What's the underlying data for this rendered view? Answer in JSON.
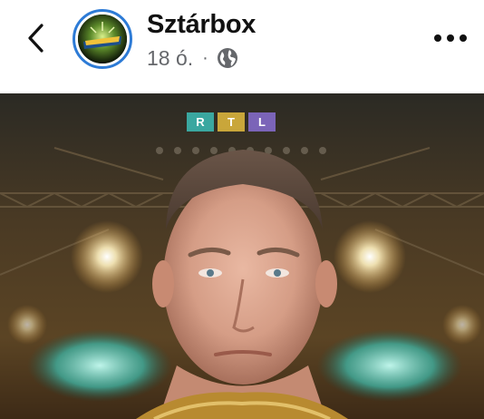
{
  "header": {
    "page_name": "Sztárbox",
    "time": "18 ó.",
    "separator": "·"
  },
  "icons": {
    "back": "chevron-left-icon",
    "privacy": "globe-icon",
    "more": "more-options-icon"
  },
  "photo": {
    "logo_letters": [
      "R",
      "T",
      "L"
    ],
    "logo_colors": [
      "#3aa7a0",
      "#c9a63a",
      "#7b64b8"
    ]
  },
  "colors": {
    "accent_ring": "#2d7bd6",
    "text_primary": "#111111",
    "text_secondary": "#65676b"
  }
}
